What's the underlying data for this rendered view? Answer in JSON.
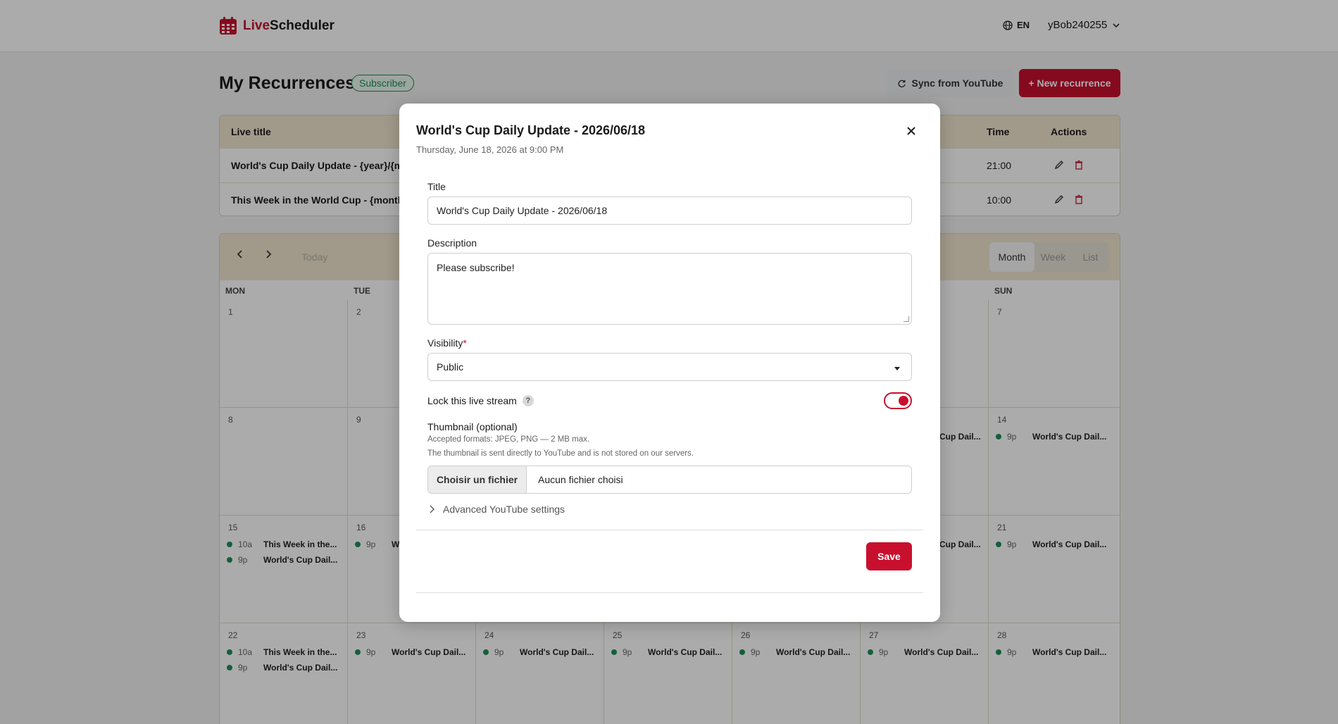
{
  "header": {
    "app_name_accent": "Live",
    "app_name_rest": "Scheduler",
    "language": "EN",
    "username": "yBob240255"
  },
  "page": {
    "title": "My Recurrences",
    "badge": "Subscriber",
    "sync_label": "Sync from YouTube",
    "new_label": "+ New recurrence"
  },
  "recurrences": {
    "columns": {
      "title": "Live title",
      "time": "Time",
      "actions": "Actions"
    },
    "rows": [
      {
        "title": "World's Cup Daily Update - {year}/{mon",
        "time": "21:00"
      },
      {
        "title": "This Week in the World Cup - {month_r",
        "time": "10:00"
      }
    ]
  },
  "calendar": {
    "today_label": "Today",
    "views": [
      "Month",
      "Week",
      "List"
    ],
    "active_view": "Month",
    "day_names": [
      "MON",
      "TUE",
      "",
      "",
      "",
      "",
      "SUN"
    ],
    "weeks": [
      [
        "1",
        "2",
        "",
        "",
        "",
        "",
        "7"
      ],
      [
        "8",
        "9",
        "",
        "",
        "",
        "",
        "14"
      ],
      [
        "15",
        "16",
        "",
        "",
        "",
        "",
        "21"
      ],
      [
        "22",
        "23",
        "24",
        "25",
        "26",
        "27",
        "28"
      ]
    ],
    "events": [
      {
        "week": 1,
        "day": 5,
        "time": "",
        "title": "Cup Dail..."
      },
      {
        "week": 1,
        "day": 6,
        "time": "9p",
        "title": "World's Cup Dail..."
      },
      {
        "week": 2,
        "day": 0,
        "time": "10a",
        "title": "This Week in the..."
      },
      {
        "week": 2,
        "day": 0,
        "time": "9p",
        "title": "World's Cup Dail..."
      },
      {
        "week": 2,
        "day": 1,
        "time": "9p",
        "title": "W"
      },
      {
        "week": 2,
        "day": 5,
        "time": "",
        "title": "Cup Dail..."
      },
      {
        "week": 2,
        "day": 6,
        "time": "9p",
        "title": "World's Cup Dail..."
      },
      {
        "week": 3,
        "day": 0,
        "time": "10a",
        "title": "This Week in the..."
      },
      {
        "week": 3,
        "day": 0,
        "time": "9p",
        "title": "World's Cup Dail..."
      },
      {
        "week": 3,
        "day": 1,
        "time": "9p",
        "title": "World's Cup Dail..."
      },
      {
        "week": 3,
        "day": 2,
        "time": "9p",
        "title": "World's Cup Dail..."
      },
      {
        "week": 3,
        "day": 3,
        "time": "9p",
        "title": "World's Cup Dail..."
      },
      {
        "week": 3,
        "day": 4,
        "time": "9p",
        "title": "World's Cup Dail..."
      },
      {
        "week": 3,
        "day": 5,
        "time": "9p",
        "title": "World's Cup Dail..."
      },
      {
        "week": 3,
        "day": 6,
        "time": "9p",
        "title": "World's Cup Dail..."
      }
    ]
  },
  "modal": {
    "title": "World's Cup Daily Update - 2026/06/18",
    "subtitle": "Thursday, June 18, 2026 at 9:00 PM",
    "title_label": "Title",
    "title_value": "World's Cup Daily Update - 2026/06/18",
    "description_label": "Description",
    "description_value": "Please subscribe!",
    "visibility_label": "Visibility",
    "visibility_required": "*",
    "visibility_value": "Public",
    "lock_label": "Lock this live stream",
    "lock_help": "?",
    "lock_enabled": true,
    "thumbnail_label": "Thumbnail (optional)",
    "thumbnail_help_1": "Accepted formats: JPEG, PNG — 2 MB max.",
    "thumbnail_help_2": "The thumbnail is sent directly to YouTube and is not stored on our servers.",
    "file_button": "Choisir un fichier",
    "file_status": "Aucun fichier choisi",
    "advanced_label": "Advanced YouTube settings",
    "save_label": "Save"
  },
  "colors": {
    "brand": "#c8102e",
    "status_green": "#1e8e5a",
    "panel_header": "#f1e6d0"
  },
  "icons": [
    "calendar-logo-icon",
    "globe-icon",
    "chevron-down-icon",
    "sync-icon",
    "edit-icon",
    "trash-icon",
    "chevron-left-icon",
    "chevron-right-icon",
    "close-icon",
    "chevron-right-icon"
  ]
}
